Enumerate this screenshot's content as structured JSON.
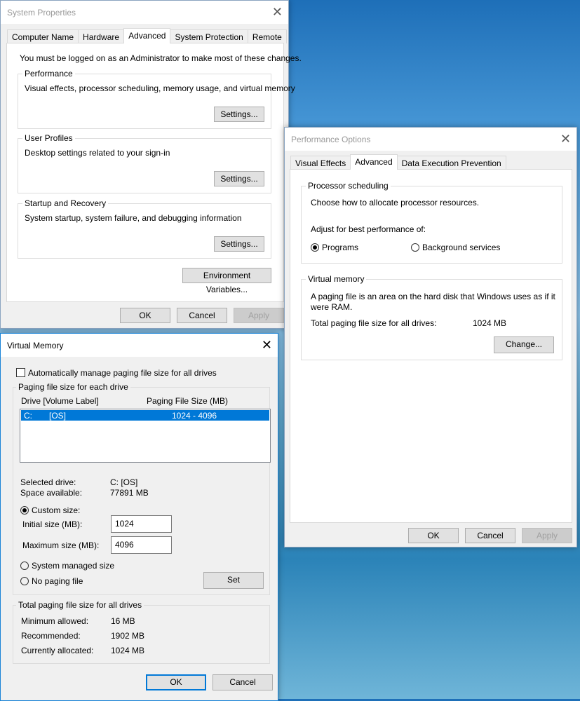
{
  "system_properties": {
    "title": "System Properties",
    "tabs": [
      "Computer Name",
      "Hardware",
      "Advanced",
      "System Protection",
      "Remote"
    ],
    "admin_notice": "You must be logged on as an Administrator to make most of these changes.",
    "performance": {
      "label": "Performance",
      "desc": "Visual effects, processor scheduling, memory usage, and virtual memory",
      "button": "Settings..."
    },
    "user_profiles": {
      "label": "User Profiles",
      "desc": "Desktop settings related to your sign-in",
      "button": "Settings..."
    },
    "startup": {
      "label": "Startup and Recovery",
      "desc": "System startup, system failure, and debugging information",
      "button": "Settings..."
    },
    "env_button": "Environment Variables...",
    "ok": "OK",
    "cancel": "Cancel",
    "apply": "Apply"
  },
  "performance_options": {
    "title": "Performance Options",
    "tabs": [
      "Visual Effects",
      "Advanced",
      "Data Execution Prevention"
    ],
    "scheduling": {
      "label": "Processor scheduling",
      "desc": "Choose how to allocate processor resources.",
      "adjust": "Adjust for best performance of:",
      "programs": "Programs",
      "background": "Background services"
    },
    "vm": {
      "label": "Virtual memory",
      "desc": "A paging file is an area on the hard disk that Windows uses as if it were RAM.",
      "total_label": "Total paging file size for all drives:",
      "total_value": "1024 MB",
      "change": "Change..."
    },
    "ok": "OK",
    "cancel": "Cancel",
    "apply": "Apply"
  },
  "virtual_memory": {
    "title": "Virtual Memory",
    "auto_manage": "Automatically manage paging file size for all drives",
    "each_drive_label": "Paging file size for each drive",
    "col_drive": "Drive  [Volume Label]",
    "col_size": "Paging File Size (MB)",
    "rows": [
      {
        "drive": "C:",
        "label": "[OS]",
        "size": "1024 - 4096"
      }
    ],
    "selected_drive_label": "Selected drive:",
    "selected_drive": "C:  [OS]",
    "space_label": "Space available:",
    "space": "77891 MB",
    "custom": "Custom size:",
    "initial_label": "Initial size (MB):",
    "initial": "1024",
    "max_label": "Maximum size (MB):",
    "max": "4096",
    "system_managed": "System managed size",
    "no_paging": "No paging file",
    "set": "Set",
    "totals_label": "Total paging file size for all drives",
    "min_label": "Minimum allowed:",
    "min": "16 MB",
    "rec_label": "Recommended:",
    "rec": "1902 MB",
    "cur_label": "Currently allocated:",
    "cur": "1024 MB",
    "ok": "OK",
    "cancel": "Cancel"
  }
}
